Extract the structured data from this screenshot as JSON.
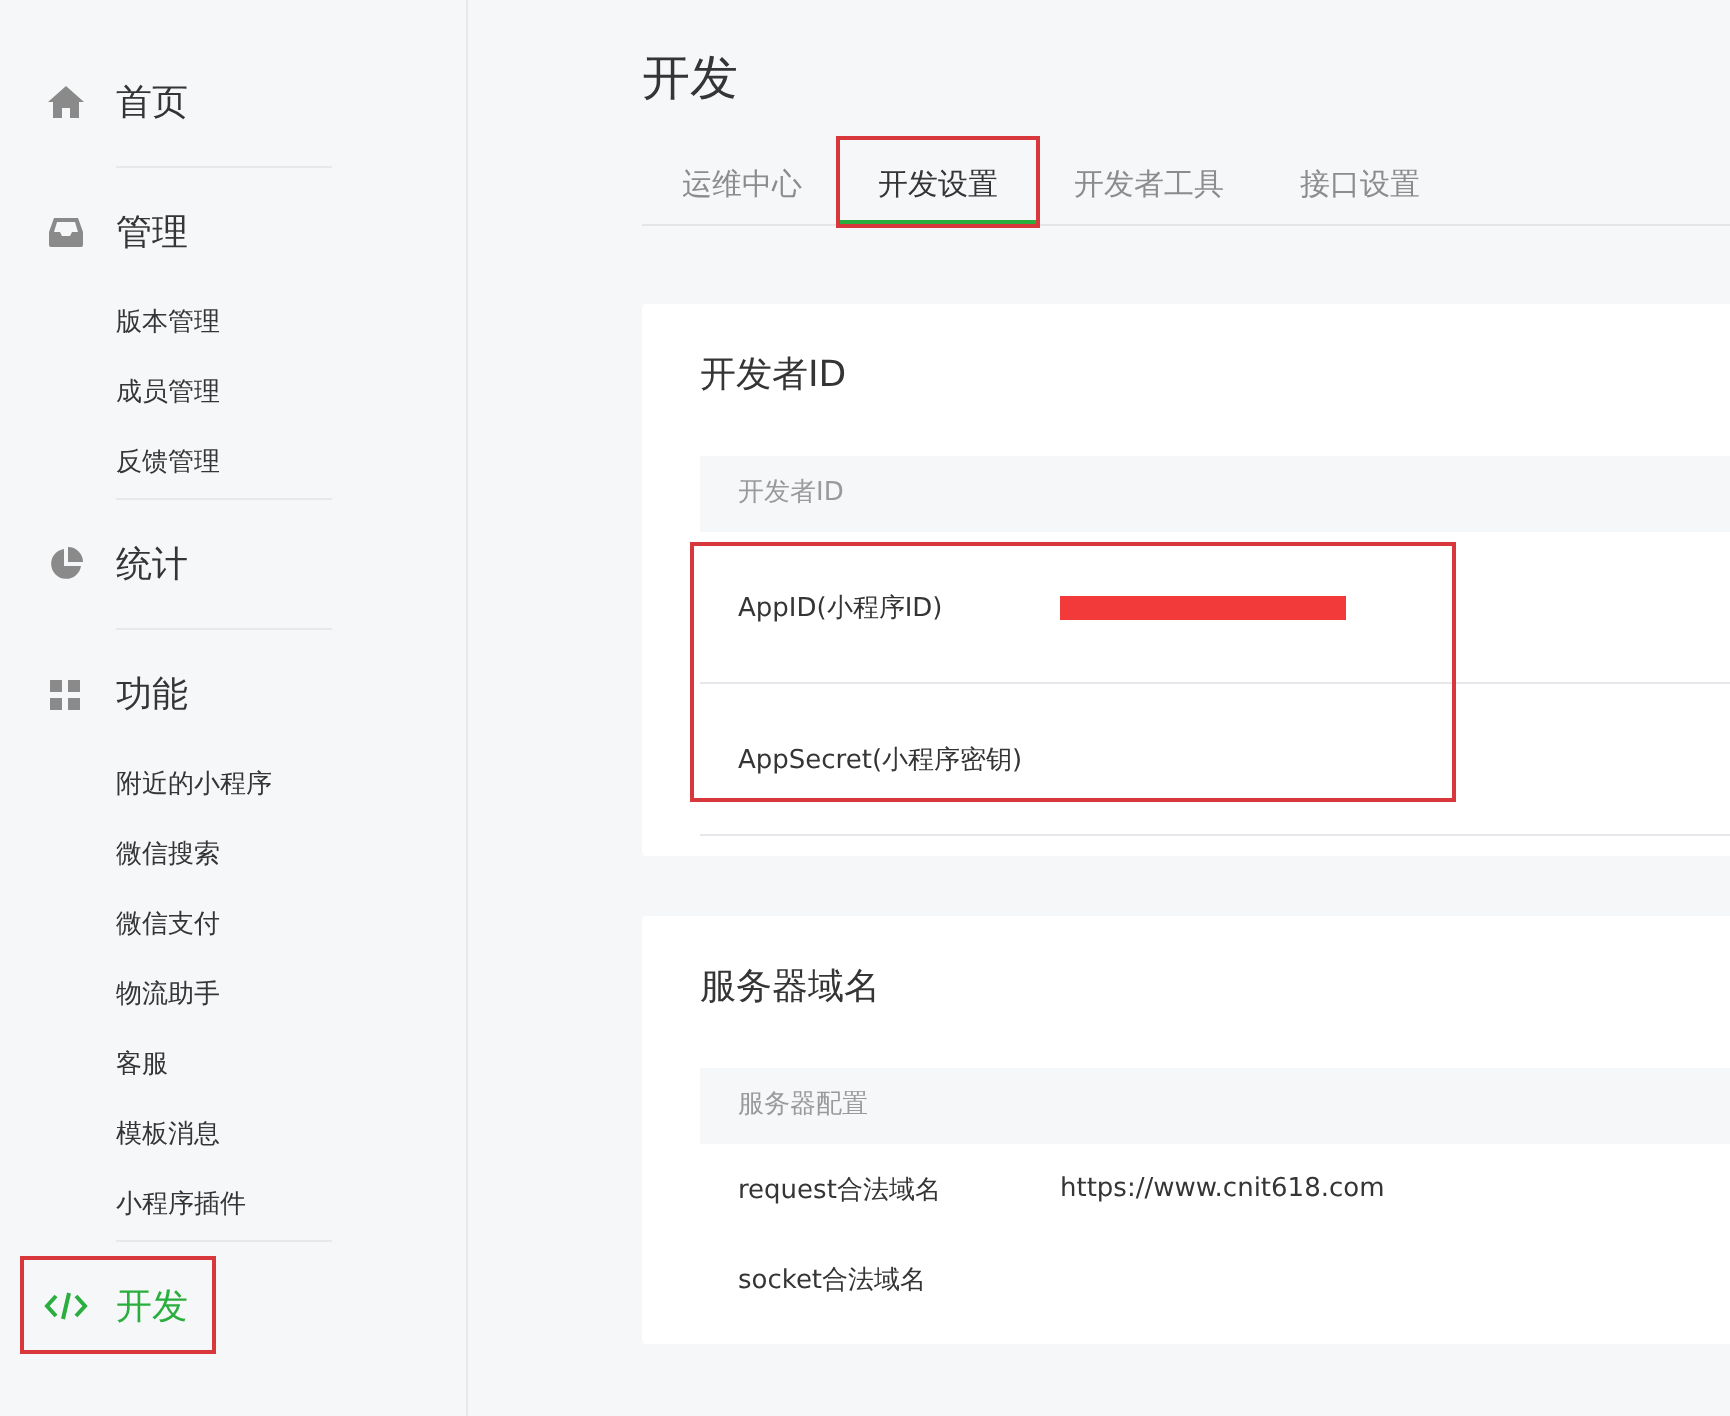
{
  "sidebar": {
    "items": [
      {
        "label": "首页",
        "selected": false,
        "highlighted": false
      },
      {
        "label": "管理",
        "selected": false,
        "highlighted": false,
        "children": [
          {
            "label": "版本管理"
          },
          {
            "label": "成员管理"
          },
          {
            "label": "反馈管理"
          }
        ]
      },
      {
        "label": "统计",
        "selected": false,
        "highlighted": false
      },
      {
        "label": "功能",
        "selected": false,
        "highlighted": false,
        "children": [
          {
            "label": "附近的小程序"
          },
          {
            "label": "微信搜索"
          },
          {
            "label": "微信支付"
          },
          {
            "label": "物流助手"
          },
          {
            "label": "客服"
          },
          {
            "label": "模板消息"
          },
          {
            "label": "小程序插件"
          }
        ]
      },
      {
        "label": "开发",
        "selected": true,
        "highlighted": true
      }
    ]
  },
  "page_title": "开发",
  "tabs": [
    {
      "label": "运维中心",
      "selected": false,
      "highlighted": false
    },
    {
      "label": "开发设置",
      "selected": true,
      "highlighted": true
    },
    {
      "label": "开发者工具",
      "selected": false,
      "highlighted": false
    },
    {
      "label": "接口设置",
      "selected": false,
      "highlighted": false
    }
  ],
  "sections": [
    {
      "title": "开发者ID",
      "table_header": "开发者ID",
      "rows_highlighted": true,
      "rows": [
        {
          "label": "AppID(小程序ID)",
          "redacted": true
        },
        {
          "label": "AppSecret(小程序密钥)",
          "redacted": false
        }
      ]
    },
    {
      "title": "服务器域名",
      "table_header": "服务器配置",
      "rows_highlighted": false,
      "rows": [
        {
          "label": "request合法域名",
          "value": "https://www.cnit618.com",
          "redacted": false
        },
        {
          "label": "socket合法域名",
          "redacted": false
        }
      ]
    }
  ]
}
